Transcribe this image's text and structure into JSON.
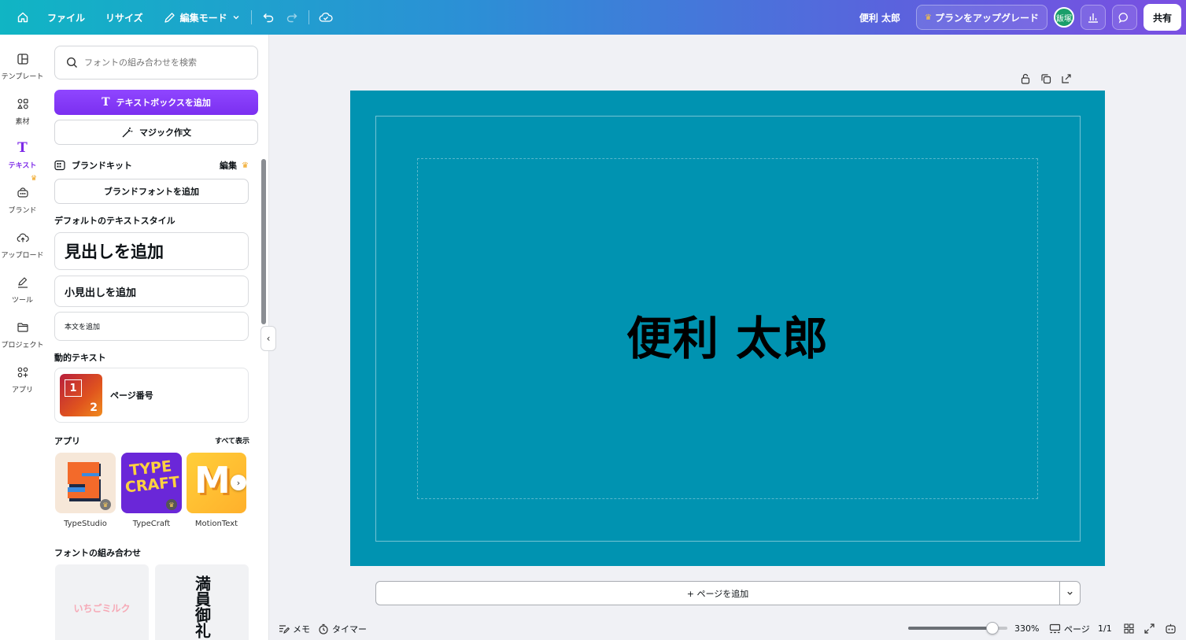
{
  "topbar": {
    "file": "ファイル",
    "resize": "リサイズ",
    "edit_mode": "編集モード",
    "user_name": "便利 太郎",
    "upgrade": "プランをアップグレード",
    "avatar_initials": "飯塚",
    "share": "共有"
  },
  "rail": {
    "items": [
      {
        "label": "テンプレート",
        "icon": "template-icon"
      },
      {
        "label": "素材",
        "icon": "elements-icon"
      },
      {
        "label": "テキスト",
        "icon": "text-icon"
      },
      {
        "label": "ブランド",
        "icon": "brand-icon"
      },
      {
        "label": "アップロード",
        "icon": "upload-icon"
      },
      {
        "label": "ツール",
        "icon": "pen-icon"
      },
      {
        "label": "プロジェクト",
        "icon": "folder-icon"
      },
      {
        "label": "アプリ",
        "icon": "apps-icon"
      }
    ],
    "active": "テキスト"
  },
  "panel": {
    "search_placeholder": "フォントの組み合わせを検索",
    "add_textbox": "テキストボックスを追加",
    "magic_write": "マジック作文",
    "brand_kit": "ブランドキット",
    "brand_edit": "編集",
    "add_brand_font": "ブランドフォントを追加",
    "default_styles_title": "デフォルトのテキストスタイル",
    "heading": "見出しを追加",
    "subheading": "小見出しを追加",
    "body": "本文を追加",
    "dynamic_title": "動的テキスト",
    "page_number": "ページ番号",
    "page_thumb_top": "1",
    "page_thumb_bottom": "2",
    "apps_title": "アプリ",
    "see_all": "すべて表示",
    "apps": [
      {
        "name": "TypeStudio"
      },
      {
        "name": "TypeCraft",
        "tile_text": [
          "TYPE",
          "CRAFT"
        ]
      },
      {
        "name": "MotionText",
        "tile_text": "M"
      }
    ],
    "font_combos_title": "フォントの組み合わせ",
    "font_combo_1": "いちごミルク",
    "font_combo_2": "満員御礼"
  },
  "canvas": {
    "text": "便利 太郎",
    "background": "#0093b1",
    "add_page": "+ ページを追加"
  },
  "bottombar": {
    "memo": "メモ",
    "timer": "タイマー",
    "zoom": "330%",
    "zoom_fraction": 0.85,
    "pages_label": "ページ",
    "page_count": "1/1"
  }
}
